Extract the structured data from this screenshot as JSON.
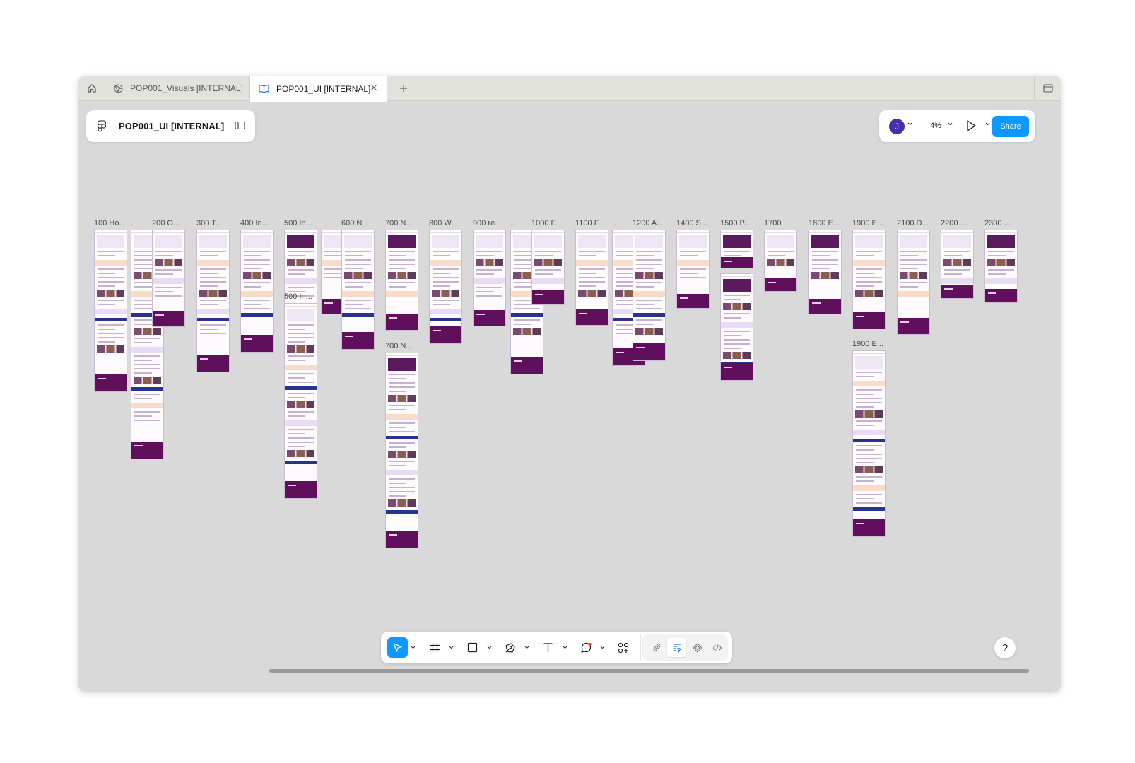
{
  "tabs": [
    {
      "label": "POP001_Visuals [INTERNAL]",
      "icon": "prototype-icon",
      "active": false
    },
    {
      "label": "POP001_UI [INTERNAL]",
      "icon": "book-icon",
      "active": true
    }
  ],
  "file": {
    "title": "POP001_UI [INTERNAL]"
  },
  "header": {
    "avatar_initial": "J",
    "zoom": "4%",
    "share_label": "Share"
  },
  "help_label": "?",
  "frames": [
    {
      "label": "100 Ho...",
      "h": 230,
      "theme": "a"
    },
    {
      "label": "...",
      "h": 325,
      "theme": "b"
    },
    {
      "label": "200 O...",
      "h": 138,
      "theme": "c"
    },
    {
      "label": "300 T...",
      "h": 202,
      "theme": "d"
    },
    {
      "label": "400 In...",
      "h": 174,
      "theme": "e"
    },
    {
      "label": "500 In...",
      "h": 145,
      "theme": "f"
    },
    {
      "label": "...",
      "h": 120,
      "theme": "g"
    },
    {
      "label": "600 N...",
      "h": 170,
      "theme": "e"
    },
    {
      "label": "700 N...",
      "h": 143,
      "theme": "h"
    },
    {
      "label": "800 W...",
      "h": 162,
      "theme": "a"
    },
    {
      "label": "900 re...",
      "h": 137,
      "theme": "c"
    },
    {
      "label": "...",
      "h": 205,
      "theme": "b"
    },
    {
      "label": "1000 F...",
      "h": 107,
      "theme": "c"
    },
    {
      "label": "1100 F...",
      "h": 136,
      "theme": "d"
    },
    {
      "label": "...",
      "h": 193,
      "theme": "g"
    },
    {
      "label": "1200 A...",
      "h": 186,
      "theme": "e"
    },
    {
      "label": "1400 S...",
      "h": 112,
      "theme": "d"
    },
    {
      "label": "1500 P...",
      "h": 55,
      "theme": "f"
    },
    {
      "label": "1700 ...",
      "h": 88,
      "theme": "c"
    },
    {
      "label": "1800 E...",
      "h": 120,
      "theme": "h"
    },
    {
      "label": "1900 E...",
      "h": 141,
      "theme": "a"
    },
    {
      "label": "2100 D...",
      "h": 149,
      "theme": "e"
    },
    {
      "label": "2200 ...",
      "h": 98,
      "theme": "c"
    },
    {
      "label": "2300 ...",
      "h": 104,
      "theme": "f"
    }
  ],
  "second_row_frames": [
    {
      "label": "500 In...",
      "h": 277,
      "theme": "b"
    },
    {
      "label": "700 N...",
      "h": 277,
      "theme": "h"
    },
    {
      "label": "1900 E...",
      "h": 264,
      "theme": "a"
    }
  ],
  "extra_frame": {
    "h": 152,
    "theme": "f"
  },
  "toolbar": {
    "tools": [
      "move-tool",
      "frame-tool",
      "shape-tool",
      "pen-tool",
      "text-tool",
      "comment-tool",
      "actions-tool"
    ],
    "modes": [
      "draw-mode",
      "design-mode",
      "prototype-mode",
      "dev-mode"
    ],
    "active_tool": "move-tool",
    "active_mode": "design-mode"
  },
  "colors": {
    "accent": "#0d99ff",
    "avatar": "#4a2ea6",
    "frame_footer": "#5f0f5c"
  }
}
